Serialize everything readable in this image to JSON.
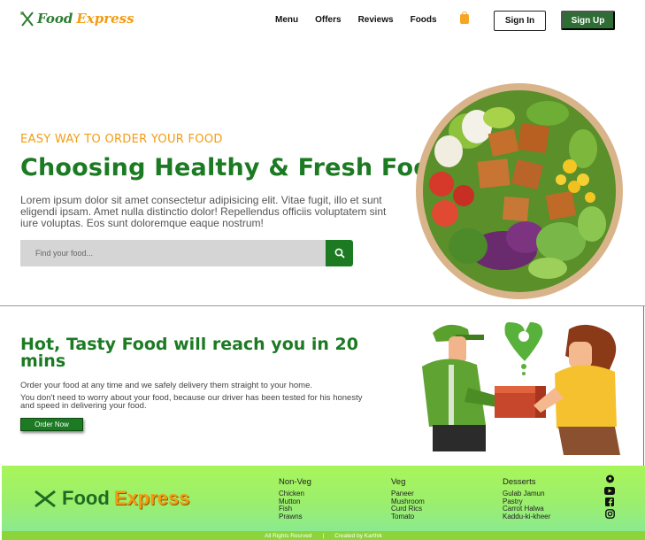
{
  "brand": {
    "word1": "Food",
    "word2": "Express"
  },
  "nav": {
    "items": [
      {
        "label": "Menu"
      },
      {
        "label": "Offers"
      },
      {
        "label": "Reviews"
      },
      {
        "label": "Foods"
      }
    ],
    "signin_label": "Sign In",
    "signup_label": "Sign Up"
  },
  "hero": {
    "eyebrow": "EASY WAY TO ORDER YOUR FOOD",
    "title": "Choosing Healthy & Fresh Food",
    "text": "Lorem ipsum dolor sit amet consectetur adipisicing elit. Vitae fugit, illo et sunt eligendi ipsam. Amet nulla distinctio dolor! Repellendus officiis voluptatem sint iure voluptas. Eos sunt doloremque eaque nostrum!",
    "search_placeholder": "Find your food..."
  },
  "delivery": {
    "title": "Hot, Tasty Food will reach you in 20 mins",
    "p1": "Order your food at any time and we safely delivery them straight to your home.",
    "p2": "You don't need to worry about your food, because our driver has been tested for his honesty and speed in delivering your food.",
    "button": "Order Now"
  },
  "footer": {
    "logo": {
      "word1": "Food",
      "word2": "Express"
    },
    "columns": [
      {
        "title": "Non-Veg",
        "items": [
          "Chicken",
          "Mutton",
          "Fish",
          "Prawns"
        ]
      },
      {
        "title": "Veg",
        "items": [
          "Paneer",
          "Mushroom",
          "Curd Rics",
          "Tomato"
        ]
      },
      {
        "title": "Desserts",
        "items": [
          "Gulab Jamun",
          "Pastry",
          "Carrot Halwa",
          "Kaddu-ki-kheer"
        ]
      }
    ],
    "social": [
      "location-icon",
      "youtube-icon",
      "facebook-icon",
      "instagram-icon"
    ],
    "rights": "All Rights Resrved",
    "separator": "|",
    "credit": "Created by Karthik"
  },
  "colors": {
    "brand_green": "#1b7a22",
    "accent_orange": "#f39c12",
    "footer_green": "#a8f55a"
  }
}
